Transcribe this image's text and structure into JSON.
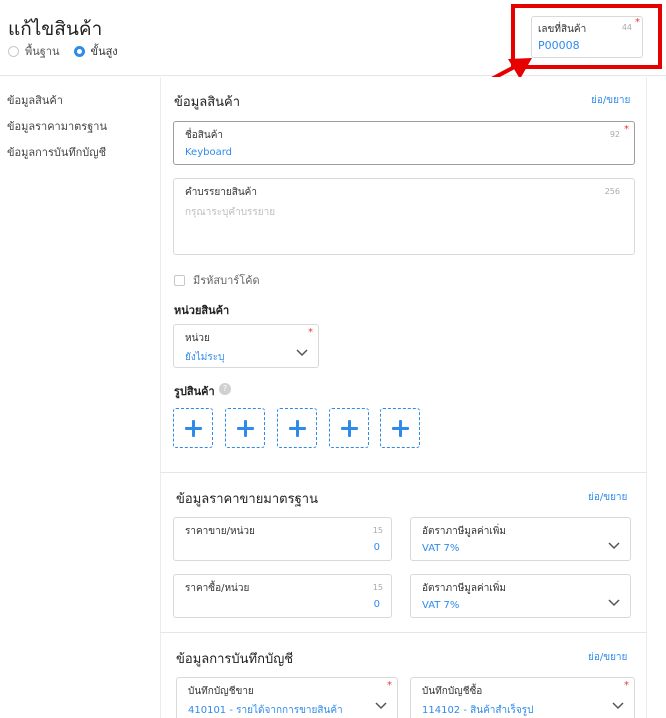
{
  "header": {
    "title": "แก้ไขสินค้า",
    "modes": [
      {
        "label": "พื้นฐาน",
        "selected": false
      },
      {
        "label": "ขั้นสูง",
        "selected": true
      }
    ],
    "product_code": {
      "label": "เลขที่สินค้า",
      "count": "44",
      "required": "*",
      "value": "P00008"
    }
  },
  "nav": {
    "items": [
      {
        "label": "ข้อมูลสินค้า"
      },
      {
        "label": "ข้อมูลราคามาตรฐาน"
      },
      {
        "label": "ข้อมูลการบันทึกบัญชี"
      }
    ]
  },
  "product_info": {
    "title": "ข้อมูลสินค้า",
    "toggle": "ย่อ/ขยาย",
    "name": {
      "label": "ชื่อสินค้า",
      "count": "92",
      "required": "*",
      "value": "Keyboard"
    },
    "description": {
      "label": "คำบรรยายสินค้า",
      "count": "256",
      "placeholder": "กรุณาระบุคำบรรยาย"
    },
    "barcode_label": "มีรหัสบาร์โค้ด",
    "unit_title": "หน่วยสินค้า",
    "unit": {
      "label": "หน่วย",
      "required": "*",
      "value": "ยังไม่ระบุ"
    },
    "images_title": "รูปสินค้า",
    "help": "?"
  },
  "pricing": {
    "title": "ข้อมูลราคาขายมาตรฐาน",
    "toggle": "ย่อ/ขยาย",
    "sell_price": {
      "label": "ราคาขาย/หน่วย",
      "count": "15",
      "value": "0"
    },
    "sell_vat": {
      "label": "อัตราภาษีมูลค่าเพิ่ม",
      "value": "VAT 7%"
    },
    "buy_price": {
      "label": "ราคาซื้อ/หน่วย",
      "count": "15",
      "value": "0"
    },
    "buy_vat": {
      "label": "อัตราภาษีมูลค่าเพิ่ม",
      "value": "VAT 7%"
    }
  },
  "accounting": {
    "title": "ข้อมูลการบันทึกบัญชี",
    "toggle": "ย่อ/ขยาย",
    "sales_account": {
      "label": "บันทึกบัญชีขาย",
      "required": "*",
      "value": "410101 - รายได้จากการขายสินค้า"
    },
    "purchase_account": {
      "label": "บันทึกบัญชีซื้อ",
      "required": "*",
      "value": "114102 - สินค้าสำเร็จรูป"
    }
  },
  "colors": {
    "accent": "#2f8bea",
    "required": "#e53935",
    "highlight": "#e60000"
  },
  "icons": [
    "chevron-down-icon",
    "plus-icon",
    "help-icon",
    "arrow-annotation"
  ]
}
